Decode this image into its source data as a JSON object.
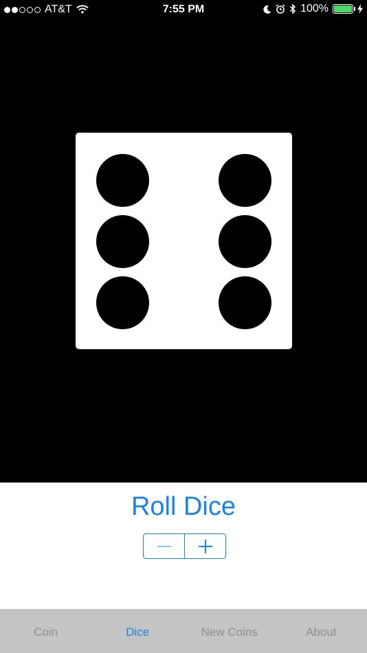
{
  "status_bar": {
    "carrier": "AT&T",
    "time": "7:55 PM",
    "battery": "100%",
    "signal_bars": 2,
    "signal_total": 5
  },
  "die": {
    "value": 6
  },
  "controls": {
    "roll_label": "Roll Dice",
    "decrement_icon": "minus-icon",
    "increment_icon": "plus-icon"
  },
  "tabs": [
    {
      "label": "Coin",
      "active": false
    },
    {
      "label": "Dice",
      "active": true
    },
    {
      "label": "New Coins",
      "active": false
    },
    {
      "label": "About",
      "active": false
    }
  ],
  "colors": {
    "accent": "#1a82e8",
    "battery": "#4cd964",
    "tab_bar": "#c4c4c4",
    "tab_inactive": "#8e8e8e"
  }
}
